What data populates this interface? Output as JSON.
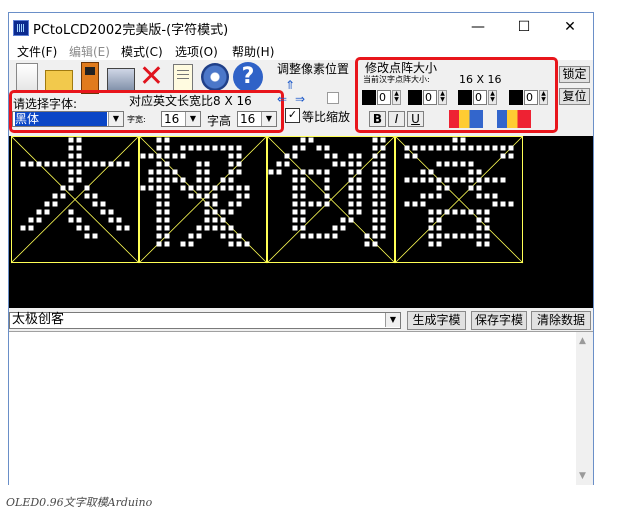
{
  "window": {
    "title": "PCtoLCD2002完美版-(字符模式)",
    "controls": {
      "minimize": "—",
      "maximize": "☐",
      "close": "✕"
    }
  },
  "menu": [
    {
      "label": "文件(F)",
      "enabled": true
    },
    {
      "label": "编辑(E)",
      "enabled": false
    },
    {
      "label": "模式(C)",
      "enabled": true
    },
    {
      "label": "选项(O)",
      "enabled": true
    },
    {
      "label": "帮助(H)",
      "enabled": true
    }
  ],
  "font_panel": {
    "prompt": "请选择字体:",
    "font_value": "黑体",
    "width_caption": "对应英文长宽比",
    "width_ratio": "8 X 16",
    "char_width_label": "字宽:",
    "char_width_value": "16",
    "char_height_label": "字高",
    "char_height_value": "16"
  },
  "pixel_position": {
    "label": "调整像素位置",
    "proportional_checkbox_label": "等比缩放",
    "proportional_checked": true
  },
  "dot_matrix": {
    "title": "修改点阵大小",
    "current_label": "当前汉字点阵大小:",
    "current_value": "16 X 16",
    "spinners": [
      "0",
      "0",
      "0",
      "0"
    ],
    "format_buttons": [
      "B",
      "I",
      "U"
    ],
    "lock_button": "锁定",
    "reset_button": "复位"
  },
  "input": {
    "text": "太极创客",
    "generate_button": "生成字模",
    "save_button": "保存字模",
    "clear_button": "清除数据"
  },
  "preview": {
    "grid_color": "#ffff55",
    "dot_color": "#ffffff",
    "background": "#000000"
  },
  "caption": "OLED0.96文字取模Arduino"
}
